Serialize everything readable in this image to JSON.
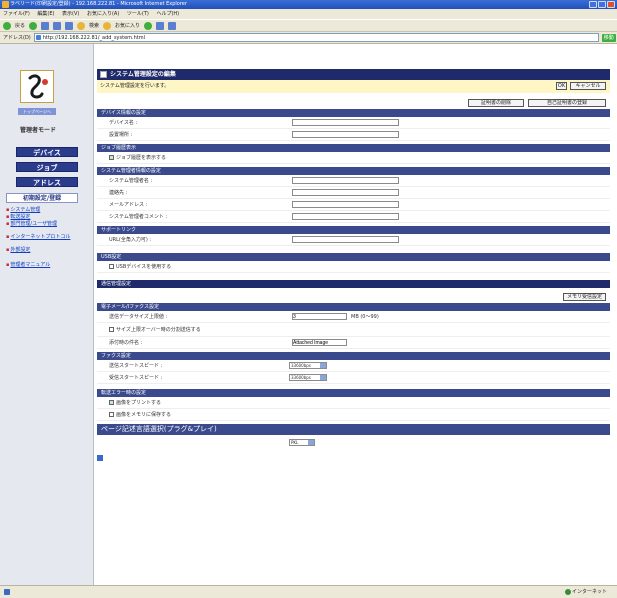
{
  "browser": {
    "title": "ラベリード(印刷設定/登録) - 192.168.222.81 - Microsoft Internet Explorer",
    "menu": [
      "ファイル(F)",
      "編集(E)",
      "表示(V)",
      "お気に入り(A)",
      "ツール(T)",
      "ヘルプ(H)"
    ],
    "toolbar": {
      "back": "戻る",
      "search": "検索",
      "favorites": "お気に入り"
    },
    "address_label": "アドレス(D)",
    "address": "http://192.168.222.81/_add_system.html",
    "go": "移動",
    "status": "インターネット"
  },
  "sidebar": {
    "logo_sub": "トップページへ",
    "mode": "管理者モード",
    "nav": [
      {
        "label": "デバイス"
      },
      {
        "label": "ジョブ"
      },
      {
        "label": "アドレス"
      }
    ],
    "settings": "初期設定/登録",
    "links": [
      "システム管理",
      "転送設定",
      "部門管理/ユーザ管理",
      "インターネットプロトコル",
      "外部設定"
    ],
    "manual": "管理者マニュアル"
  },
  "main": {
    "header": "システム管理設定の編集",
    "notice": "システム管理設定を行います。",
    "ok": "OK",
    "cancel": "キャンセル",
    "btn_cert": "証明書の削除",
    "btn_cert2": "自己証明書の登録",
    "sec_device": "デバイス情報の設定",
    "device_name": "デバイス名 :",
    "install_place": "設置場所 :",
    "sec_job": "ジョブ履歴表示",
    "job_check": "ジョブ履歴を表示する",
    "sec_admin": "システム管理者情報の設定",
    "admin_name": "システム管理者名 :",
    "contact": "連絡先 :",
    "email": "メールアドレス :",
    "admin_comment": "システム管理者コメント :",
    "sec_support": "サポートリンク",
    "url": "URL(全角入力可) :",
    "sec_usb": "USB設定",
    "usb_check": "USBデバイスを使用する",
    "sec_comm": "通信管理設定",
    "btn_mail": "メモリ受信設定",
    "sec_mail_fax": "電子メール/Iファクス設定",
    "send_size": "送信データサイズ上限値 :",
    "send_size_value": "3",
    "send_size_unit": "MB (0～99)",
    "split_check": "サイズ上限オーバー時の分割送信する",
    "attach_name": "添付時の件名 :",
    "attach_value": "Attached Image",
    "sec_fax": "ファクス設定",
    "send_speed": "送信スタートスピード :",
    "send_speed_value": "33600bps",
    "recv_speed": "受信スタートスピード :",
    "recv_speed_value": "33600bps",
    "sec_error": "転送エラー時の設定",
    "print_check": "画像をプリントする",
    "save_check": "画像をメモリに保存する",
    "sec_pdl": "ページ記述言語選択(プラグ&プレイ)",
    "pdl_value": "PKL"
  },
  "colors": {
    "navy": "#1f2a6a",
    "section": "#3a4a8c",
    "notice_bg": "#fff6c6",
    "sidebar_bg": "#e6e8f0"
  }
}
